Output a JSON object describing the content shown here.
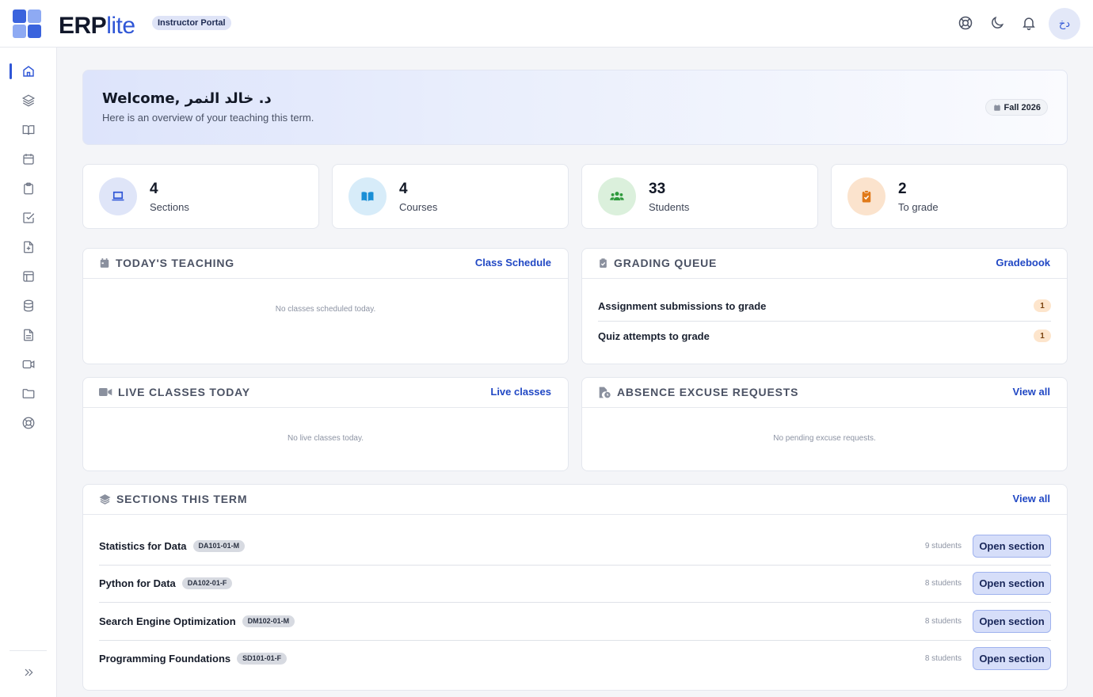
{
  "app": {
    "brand_main": "ERP",
    "brand_accent": "lite",
    "portal_badge": "Instructor Portal",
    "avatar_initials": "دخ"
  },
  "welcome": {
    "title": "Welcome, د. خالد النمر",
    "subtitle": "Here is an overview of your teaching this term.",
    "term": "Fall 2026"
  },
  "stats": [
    {
      "value": "4",
      "label": "Sections",
      "icon": "laptop-icon",
      "color": "#2f56d6",
      "bg": "#dfe5f8"
    },
    {
      "value": "4",
      "label": "Courses",
      "icon": "open-book-icon",
      "color": "#1a8fd6",
      "bg": "#d7ecf9"
    },
    {
      "value": "33",
      "label": "Students",
      "icon": "users-icon",
      "color": "#2e9a3c",
      "bg": "#dbf0dc"
    },
    {
      "value": "2",
      "label": "To grade",
      "icon": "clipboard-check-icon",
      "color": "#e07a1a",
      "bg": "#fbe3cd"
    }
  ],
  "today_teaching": {
    "title": "TODAY'S TEACHING",
    "link": "Class Schedule",
    "empty": "No classes scheduled today."
  },
  "grading_queue": {
    "title": "GRADING QUEUE",
    "link": "Gradebook",
    "items": [
      {
        "label": "Assignment submissions to grade",
        "count": "1"
      },
      {
        "label": "Quiz attempts to grade",
        "count": "1"
      }
    ]
  },
  "live_classes": {
    "title": "LIVE CLASSES TODAY",
    "link": "Live classes",
    "empty": "No live classes today."
  },
  "excuse_requests": {
    "title": "ABSENCE EXCUSE REQUESTS",
    "link": "View all",
    "empty": "No pending excuse requests."
  },
  "sections_term": {
    "title": "SECTIONS THIS TERM",
    "link": "View all",
    "button_label": "Open section",
    "rows": [
      {
        "name": "Statistics for Data",
        "code": "DA101-01-M",
        "students": "9 students"
      },
      {
        "name": "Python for Data",
        "code": "DA102-01-F",
        "students": "8 students"
      },
      {
        "name": "Search Engine Optimization",
        "code": "DM102-01-M",
        "students": "8 students"
      },
      {
        "name": "Programming Foundations",
        "code": "SD101-01-F",
        "students": "8 students"
      }
    ]
  },
  "sidebar": {
    "items": [
      "home-icon",
      "layers-icon",
      "book-icon",
      "calendar-icon",
      "clipboard-icon",
      "checkbox-icon",
      "file-plus-icon",
      "layout-icon",
      "database-icon",
      "file-text-icon",
      "video-icon",
      "folder-icon",
      "lifebuoy-icon"
    ],
    "active": "home-icon",
    "expand": "chevrons-right-icon"
  },
  "colors": {
    "accent": "#2f56d6",
    "link": "#2148c4",
    "badge_orange": "#fde5cc"
  }
}
